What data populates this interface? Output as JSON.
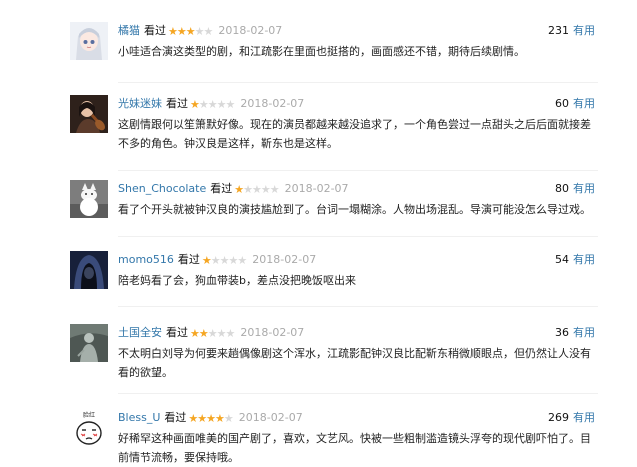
{
  "comments": [
    {
      "user": "橘猫",
      "watched": "看过",
      "rating": 3,
      "date": "2018-02-07",
      "votes": "231",
      "useful": "有用",
      "text": "小哇适合演这类型的剧，和江疏影在里面也挺搭的，画面感还不错，期待后续剧情。",
      "avatar_icon": "anime-girl-avatar-icon"
    },
    {
      "user": "光妹迷妹",
      "watched": "看过",
      "rating": 1,
      "date": "2018-02-07",
      "votes": "60",
      "useful": "有用",
      "text": "这剧情跟何以笙箫默好像。现在的演员都越来越没追求了，一个角色尝过一点甜头之后后面就接差不多的角色。钟汉良是这样，靳东也是这样。",
      "avatar_icon": "woman-with-violin-avatar-icon"
    },
    {
      "user": "Shen_Chocolate",
      "watched": "看过",
      "rating": 1,
      "date": "2018-02-07",
      "votes": "80",
      "useful": "有用",
      "text": "看了个开头就被钟汉良的演技尴尬到了。台词一塌糊涂。人物出场混乱。导演可能没怎么导过戏。",
      "avatar_icon": "white-cat-avatar-icon"
    },
    {
      "user": "momo516",
      "watched": "看过",
      "rating": 1,
      "date": "2018-02-07",
      "votes": "54",
      "useful": "有用",
      "text": "陪老妈看了会，狗血带装b，差点没把晚饭呕出来",
      "avatar_icon": "hooded-figure-avatar-icon"
    },
    {
      "user": "土国全安",
      "watched": "看过",
      "rating": 2,
      "date": "2018-02-07",
      "votes": "36",
      "useful": "有用",
      "text": "不太明白刘导为何要来趟偶像剧这个浑水，江疏影配钟汉良比配靳东稍微顺眼点，但仍然让人没有看的欲望。",
      "avatar_icon": "grey-figure-avatar-icon"
    },
    {
      "user": "Bless_U",
      "watched": "看过",
      "rating": 4,
      "date": "2018-02-07",
      "votes": "269",
      "useful": "有用",
      "text": "好稀罕这种画面唯美的国产剧了，喜欢，文艺风。快被一些粗制滥造镜头浮夸的现代剧吓怕了。目前情节流畅，要保持哦。",
      "avatar_icon": "blushing-face-avatar-icon",
      "avatar_label": "脸红"
    }
  ],
  "colors": {
    "link": "#3377aa",
    "star_on": "#f5a623",
    "star_off": "#d8d8d8",
    "date": "#aaaaaa"
  }
}
